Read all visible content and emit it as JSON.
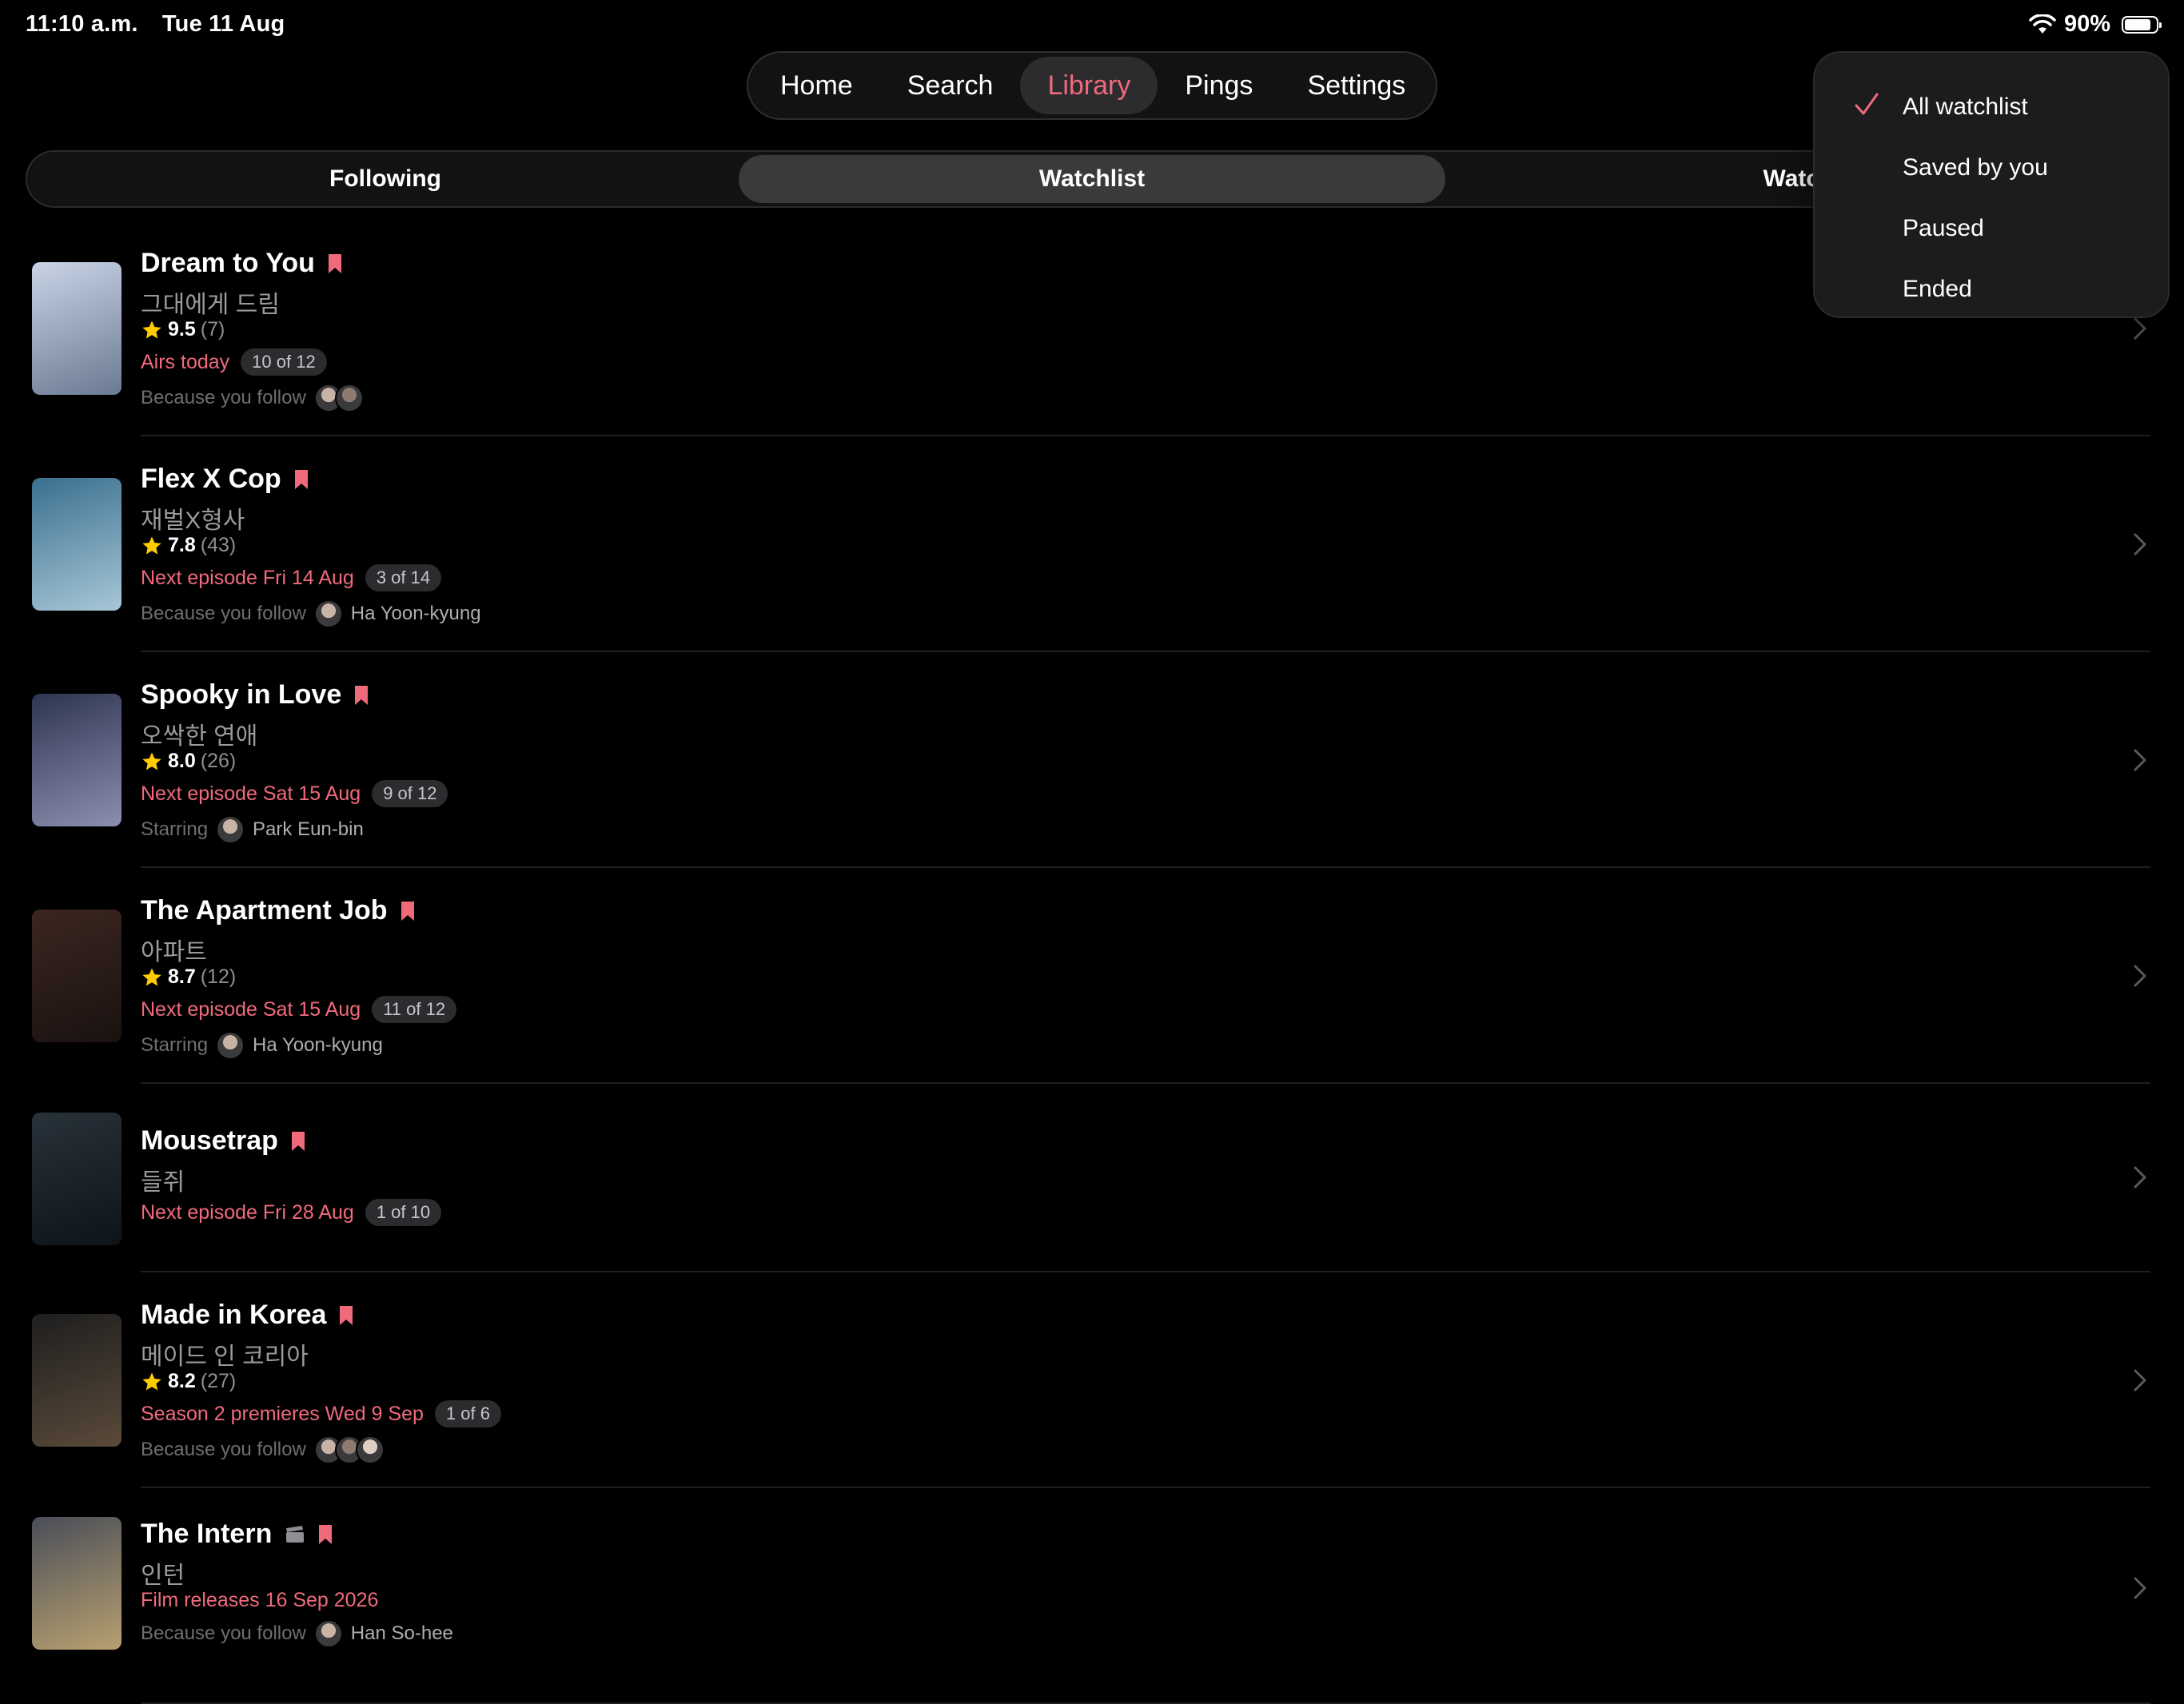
{
  "status": {
    "time": "11:10 a.m.",
    "date": "Tue 11 Aug",
    "battery": "90%",
    "battery_level": 0.9
  },
  "nav": {
    "tabs": [
      "Home",
      "Search",
      "Library",
      "Pings",
      "Settings"
    ],
    "active": "Library"
  },
  "segments": {
    "items": [
      "Following",
      "Watchlist",
      "Watch"
    ],
    "active": "Watchlist"
  },
  "filter_menu": {
    "items": [
      "All watchlist",
      "Saved by you",
      "Paused",
      "Ended"
    ],
    "selected": "All watchlist"
  },
  "colors": {
    "accent": "#f06a7c",
    "star": "#ffcc00",
    "background": "#000000"
  },
  "shows": [
    {
      "title": "Dream to You",
      "original": "그대에게 드림",
      "rating": "9.5",
      "count": "(7)",
      "next": "Airs today",
      "progress": "10 of 12",
      "reason": "Because you follow",
      "person": "",
      "avatars": 2,
      "poster": [
        "#c9d4e6",
        "#6b7a92"
      ]
    },
    {
      "title": "Flex X Cop",
      "original": "재벌X형사",
      "rating": "7.8",
      "count": "(43)",
      "next": "Next episode Fri 14 Aug",
      "progress": "3 of 14",
      "reason": "Because you follow",
      "person": "Ha Yoon-kyung",
      "avatars": 1,
      "poster": [
        "#3a6f8f",
        "#a7c7d6"
      ]
    },
    {
      "title": "Spooky in Love",
      "original": "오싹한 연애",
      "rating": "8.0",
      "count": "(26)",
      "next": "Next episode Sat 15 Aug",
      "progress": "9 of 12",
      "reason": "Starring",
      "person": "Park Eun-bin",
      "avatars": 1,
      "poster": [
        "#2e3550",
        "#8b8fb0"
      ]
    },
    {
      "title": "The Apartment Job",
      "original": "아파트",
      "rating": "8.7",
      "count": "(12)",
      "next": "Next episode Sat 15 Aug",
      "progress": "11 of 12",
      "reason": "Starring",
      "person": "Ha Yoon-kyung",
      "avatars": 1,
      "poster": [
        "#3b2620",
        "#1a1210"
      ]
    },
    {
      "title": "Mousetrap",
      "original": "들쥐",
      "rating": "",
      "count": "",
      "next": "Next episode Fri 28 Aug",
      "progress": "1 of 10",
      "reason": "",
      "person": "",
      "avatars": 0,
      "poster": [
        "#28323a",
        "#0e1418"
      ]
    },
    {
      "title": "Made in Korea",
      "original": "메이드 인 코리아",
      "rating": "8.2",
      "count": "(27)",
      "next": "Season 2 premieres Wed 9 Sep",
      "progress": "1 of 6",
      "reason": "Because you follow",
      "person": "",
      "avatars": 3,
      "poster": [
        "#1e1e1e",
        "#5a4a3a"
      ]
    },
    {
      "title": "The Intern",
      "original": "인턴",
      "rating": "",
      "count": "",
      "next": "Film releases 16 Sep 2026",
      "progress": "",
      "reason": "Because you follow",
      "person": "Han So-hee",
      "avatars": 1,
      "poster": [
        "#4a4e58",
        "#b8a070"
      ]
    }
  ]
}
